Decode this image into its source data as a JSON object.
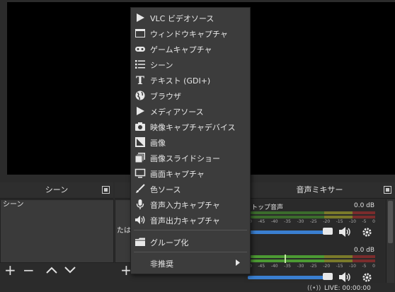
{
  "menu": {
    "items": [
      {
        "label": "VLC ビデオソース",
        "icon": "play-icon"
      },
      {
        "label": "ウィンドウキャプチャ",
        "icon": "window-icon"
      },
      {
        "label": "ゲームキャプチャ",
        "icon": "gamepad-icon"
      },
      {
        "label": "シーン",
        "icon": "list-icon"
      },
      {
        "label": "テキスト (GDI+)",
        "icon": "text-icon"
      },
      {
        "label": "ブラウザ",
        "icon": "globe-icon"
      },
      {
        "label": "メディアソース",
        "icon": "play-icon"
      },
      {
        "label": "映像キャプチャデバイス",
        "icon": "camera-icon"
      },
      {
        "label": "画像",
        "icon": "image-icon"
      },
      {
        "label": "画像スライドショー",
        "icon": "slideshow-icon"
      },
      {
        "label": "画面キャプチャ",
        "icon": "monitor-icon"
      },
      {
        "label": "色ソース",
        "icon": "brush-icon"
      },
      {
        "label": "音声入力キャプチャ",
        "icon": "microphone-icon"
      },
      {
        "label": "音声出力キャプチャ",
        "icon": "speaker-icon"
      }
    ],
    "group_label": "グループ化",
    "deprecated_label": "非推奨"
  },
  "scenes": {
    "title": "シーン",
    "items": [
      "シーン"
    ]
  },
  "sources": {
    "partial_text": "たは"
  },
  "mixer": {
    "title": "音声ミキサー",
    "channels": [
      {
        "name": "ットップ音声",
        "db": "0.0 dB",
        "volume": 0.93
      },
      {
        "name": "",
        "db": "0.0 dB",
        "volume": 0.93
      }
    ],
    "scale": [
      "-50",
      "-45",
      "-40",
      "-35",
      "-30",
      "-25",
      "-20",
      "-15",
      "-10",
      "-5",
      "0"
    ]
  },
  "status": {
    "live": "LIVE: 00:00:00"
  }
}
